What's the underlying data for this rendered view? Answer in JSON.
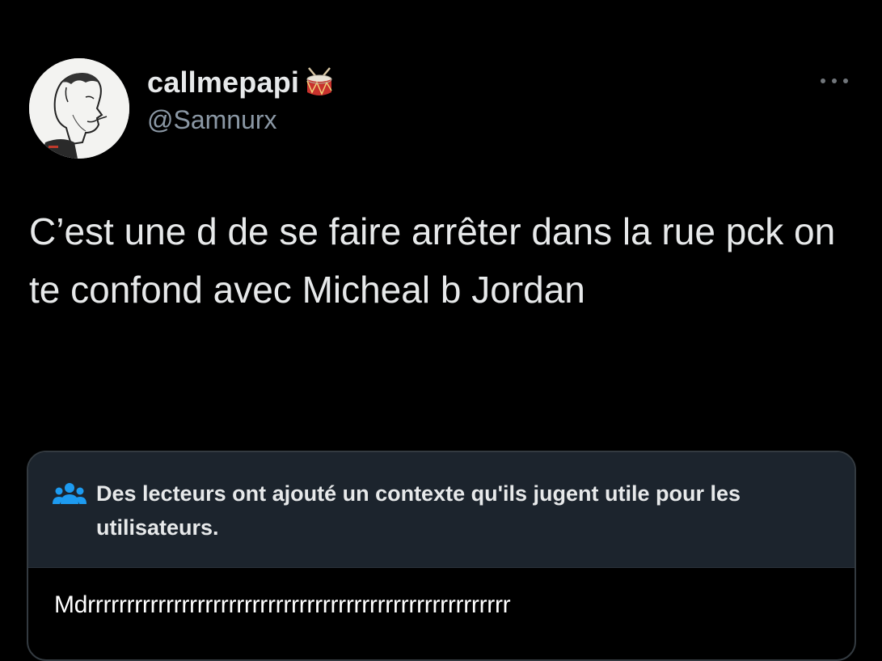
{
  "author": {
    "display_name": "callmepapi",
    "handle": "@Samnurx",
    "badge_icon": "drum-icon"
  },
  "menu": {
    "icon": "more-horizontal-icon"
  },
  "tweet": {
    "text": "C’est une d de se faire arrêter dans la rue pck on te confond avec Micheal b Jordan"
  },
  "community_note": {
    "icon": "people-icon",
    "title": "Des lecteurs ont ajouté un contexte qu'ils jugent utile pour les utilisateurs.",
    "body": "Mdrrrrrrrrrrrrrrrrrrrrrrrrrrrrrrrrrrrrrrrrrrrrrrrrrrrrrr"
  },
  "colors": {
    "background": "#000000",
    "text_primary": "#e7e9ea",
    "text_secondary": "#8b98a5",
    "note_header_bg": "#1c242d",
    "note_icon": "#1d9bf0"
  }
}
